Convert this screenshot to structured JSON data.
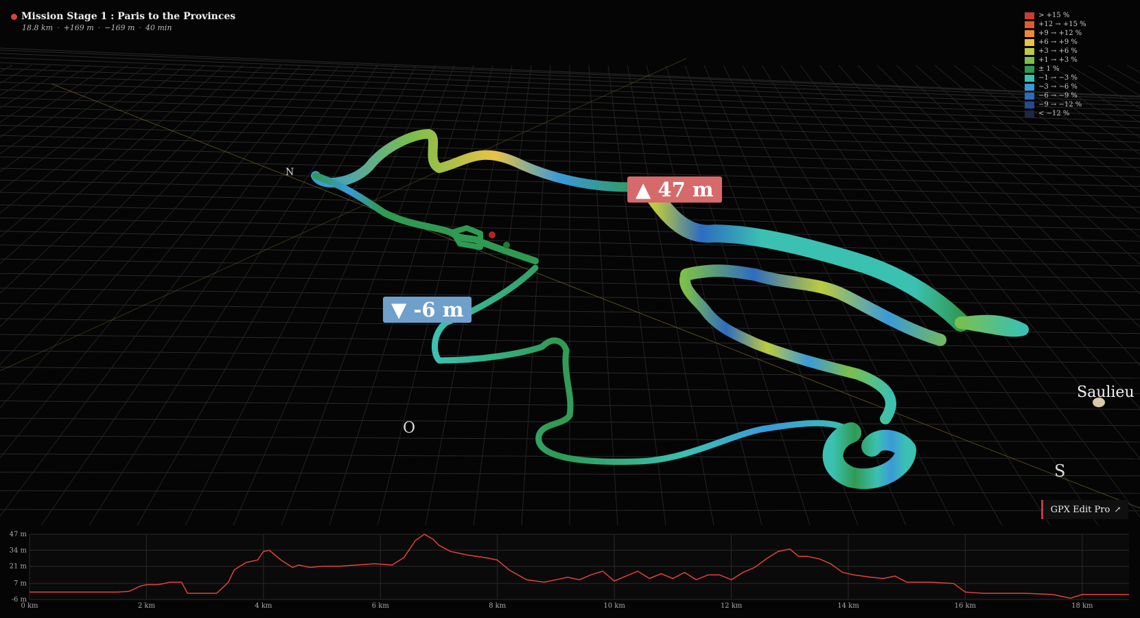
{
  "route": {
    "title": "Mission Stage 1 : Paris to the Provinces",
    "stats": {
      "distance": "18.8 km",
      "climb": "+169 m",
      "descent": "−169 m",
      "duration": "40 min"
    }
  },
  "legend": [
    {
      "label": "> +15 %",
      "color": "#d13a33"
    },
    {
      "label": "+12 → +15 %",
      "color": "#e25a32"
    },
    {
      "label": "+9 → +12 %",
      "color": "#ec8a3a"
    },
    {
      "label": "+6 → +9 %",
      "color": "#e9c246"
    },
    {
      "label": "+3 → +6 %",
      "color": "#bccb3e"
    },
    {
      "label": "+1 → +3 %",
      "color": "#7cbf4a"
    },
    {
      "label": "± 1 %",
      "color": "#2f9a52"
    },
    {
      "label": "−1 → −3 %",
      "color": "#3bc1b1"
    },
    {
      "label": "−3 → −6 %",
      "color": "#3a9ad9"
    },
    {
      "label": "−6 → −9 %",
      "color": "#2e6cc0"
    },
    {
      "label": "−9 → −12 %",
      "color": "#254a8e"
    },
    {
      "label": "< −12 %",
      "color": "#1b2846"
    }
  ],
  "compass": {
    "north": "N",
    "west": "O",
    "south": "S"
  },
  "city": {
    "name": "Saulieu"
  },
  "badges": {
    "max": "▲ 47 m",
    "min": "▼ -6 m"
  },
  "brand": {
    "label": "GPX Edit Pro",
    "arrow": "↗"
  },
  "icons": {
    "external_link": "arrow-up-right-icon"
  },
  "chart_data": {
    "type": "line",
    "xlabel": "",
    "ylabel": "",
    "x_ticks": [
      "0 km",
      "2 km",
      "4 km",
      "6 km",
      "8 km",
      "10 km",
      "12 km",
      "14 km",
      "16 km",
      "18 km"
    ],
    "y_ticks": [
      "47 m",
      "34 m",
      "21 m",
      "7 m",
      "-6 m"
    ],
    "xlim": [
      0,
      18.8
    ],
    "ylim": [
      -6,
      47
    ],
    "series": [
      {
        "color": "#e8403a",
        "x": [
          0,
          0.5,
          1.0,
          1.5,
          1.7,
          1.9,
          2.0,
          2.2,
          2.4,
          2.6,
          2.7,
          2.9,
          3.2,
          3.4,
          3.5,
          3.7,
          3.9,
          4.0,
          4.1,
          4.2,
          4.3,
          4.5,
          4.6,
          4.8,
          5.0,
          5.3,
          5.6,
          5.9,
          6.2,
          6.4,
          6.6,
          6.75,
          6.9,
          7.0,
          7.2,
          7.5,
          7.8,
          8.0,
          8.2,
          8.5,
          8.8,
          9.0,
          9.2,
          9.4,
          9.6,
          9.8,
          10.0,
          10.2,
          10.4,
          10.6,
          10.8,
          11.0,
          11.2,
          11.4,
          11.6,
          11.8,
          12.0,
          12.2,
          12.4,
          12.6,
          12.8,
          13.0,
          13.15,
          13.3,
          13.5,
          13.7,
          13.9,
          14.1,
          14.4,
          14.6,
          14.8,
          15.0,
          15.2,
          15.4,
          15.8,
          16.0,
          16.3,
          16.6,
          17.0,
          17.5,
          17.8,
          18.0,
          18.3,
          18.6,
          18.8
        ],
        "y": [
          0,
          0,
          0,
          0,
          0.5,
          5,
          6,
          6,
          8,
          8,
          -1,
          -1,
          -1,
          8,
          18,
          24,
          26,
          33,
          34,
          30,
          26,
          20,
          22,
          20,
          21,
          21,
          22,
          23,
          22,
          28,
          42,
          47,
          43,
          38,
          33,
          30,
          28,
          26,
          18,
          10,
          8,
          10,
          12,
          10,
          14,
          17,
          9,
          13,
          17,
          11,
          15,
          11,
          16,
          10,
          14,
          14,
          10,
          16,
          20,
          27,
          33,
          35,
          29,
          29,
          27,
          23,
          16,
          14,
          12,
          11,
          13,
          8,
          8,
          8,
          7,
          0,
          -1,
          -1,
          -1,
          -2,
          -5,
          -2,
          -2,
          -2,
          -2
        ]
      }
    ]
  }
}
